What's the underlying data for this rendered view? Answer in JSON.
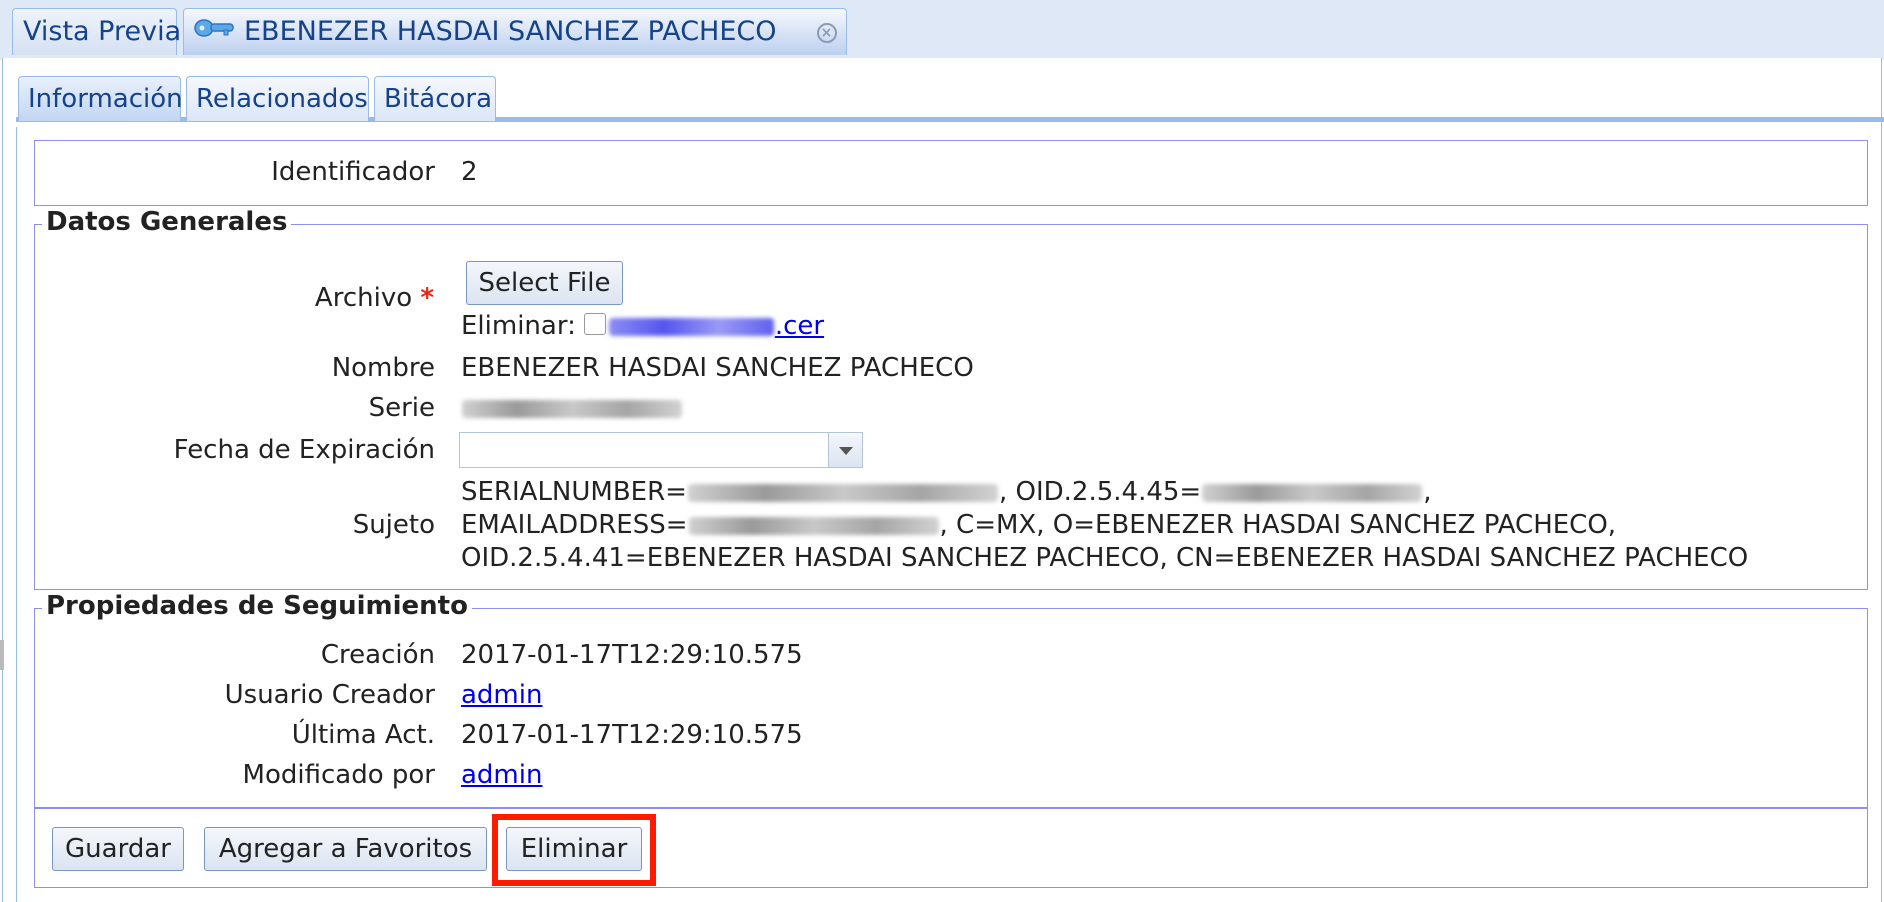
{
  "top_tabs": [
    {
      "label": "Vista Previa"
    },
    {
      "label": "EBENEZER HASDAI SANCHEZ PACHECO",
      "icon": "key-icon"
    }
  ],
  "sub_tabs": [
    {
      "label": "Información"
    },
    {
      "label": "Relacionados"
    },
    {
      "label": "Bitácora"
    }
  ],
  "identificador": {
    "label": "Identificador",
    "value": "2"
  },
  "datos_generales": {
    "legend": "Datos Generales",
    "archivo_label": "Archivo",
    "required_mark": "*",
    "select_file_label": "Select File",
    "eliminar_label": "Eliminar:",
    "file_link_suffix": ".cer",
    "nombre_label": "Nombre",
    "nombre_value": "EBENEZER HASDAI SANCHEZ PACHECO",
    "serie_label": "Serie",
    "fecha_label": "Fecha de Expiración",
    "fecha_value": "",
    "sujeto_label": "Sujeto",
    "sujeto_line1_a": "SERIALNUMBER=",
    "sujeto_line1_b": ", OID.2.5.4.45=",
    "sujeto_line1_c": ",",
    "sujeto_line2_a": "EMAILADDRESS=",
    "sujeto_line2_b": ", C=MX, O=EBENEZER HASDAI SANCHEZ PACHECO,",
    "sujeto_line3": "OID.2.5.4.41=EBENEZER HASDAI SANCHEZ PACHECO, CN=EBENEZER HASDAI SANCHEZ PACHECO"
  },
  "seguimiento": {
    "legend": "Propiedades de Seguimiento",
    "creacion_label": "Creación",
    "creacion_value": "2017-01-17T12:29:10.575",
    "usuario_label": "Usuario Creador",
    "usuario_value": "admin",
    "ultima_label": "Última Act.",
    "ultima_value": "2017-01-17T12:29:10.575",
    "modificado_label": "Modificado por",
    "modificado_value": "admin"
  },
  "buttons": {
    "guardar": "Guardar",
    "favoritos": "Agregar a Favoritos",
    "eliminar": "Eliminar"
  },
  "colors": {
    "tab_text": "#15428b",
    "border": "#99bbe8",
    "highlight": "#ff1a00",
    "link": "#0000ee"
  }
}
